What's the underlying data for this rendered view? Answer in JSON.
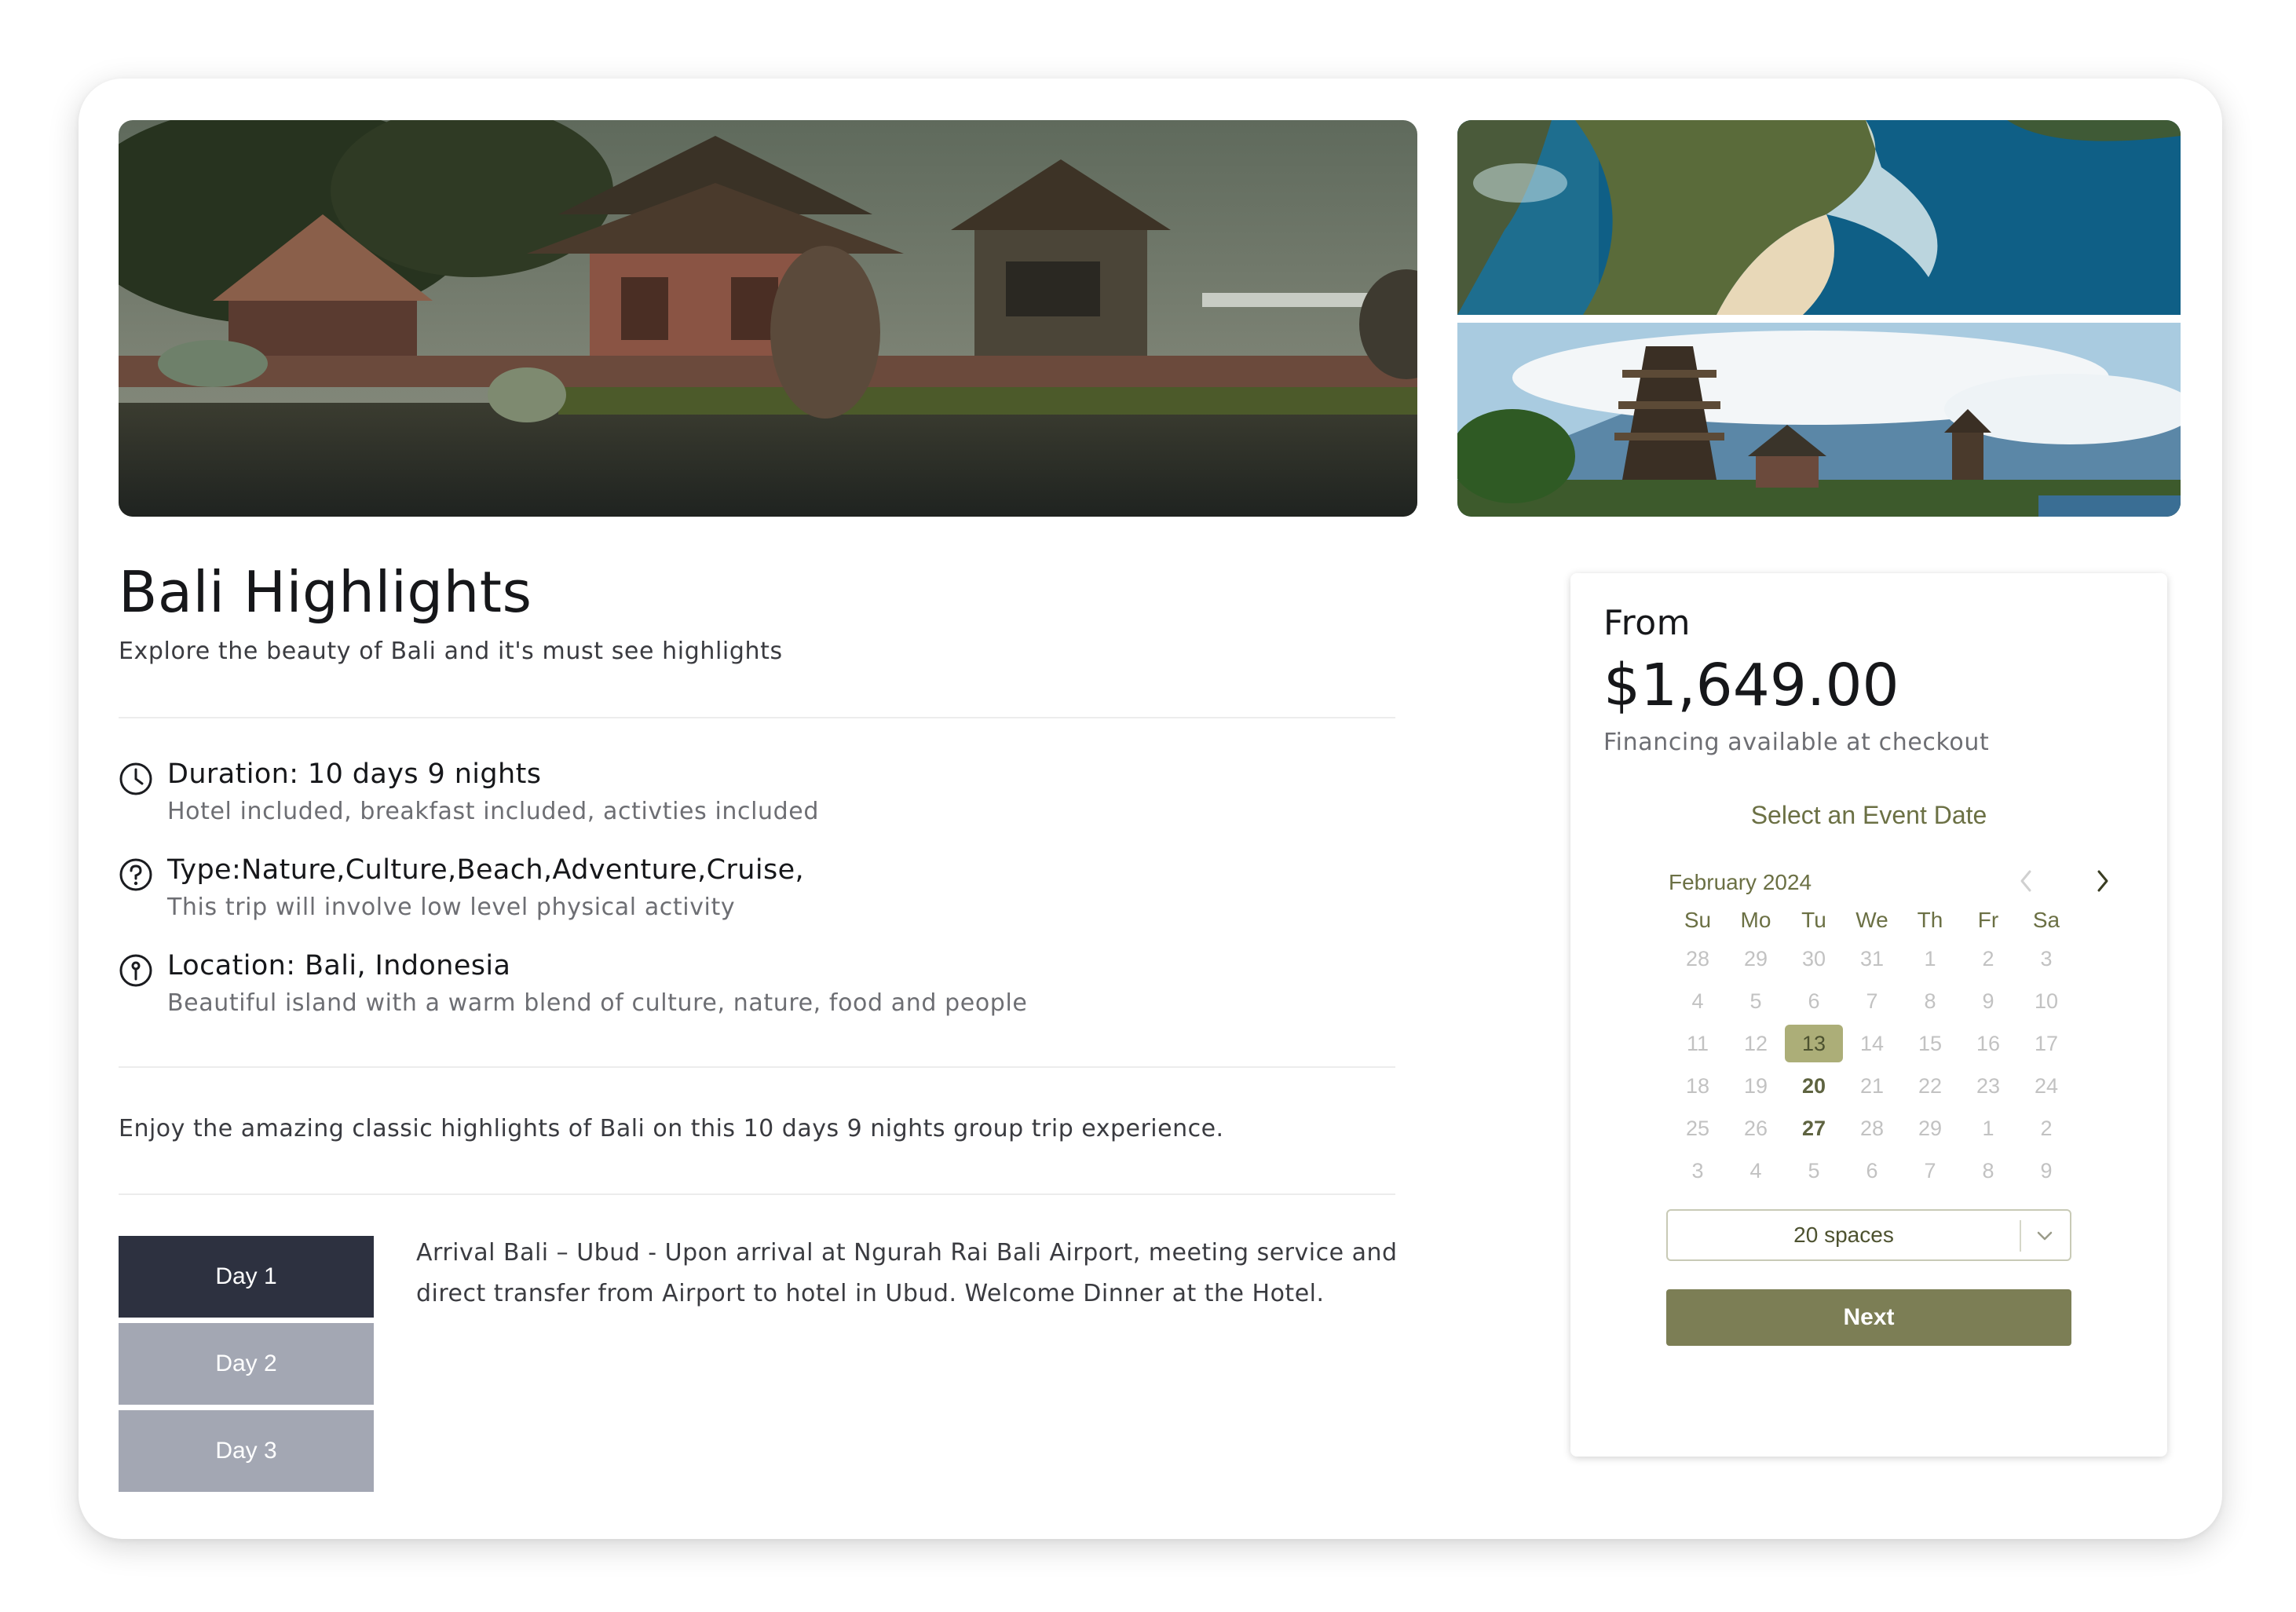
{
  "tour": {
    "title": "Bali Highlights",
    "subtitle": "Explore the beauty of Bali and it's must see highlights",
    "features": [
      {
        "icon": "clock-icon",
        "title": "Duration: 10 days 9 nights",
        "subtitle": "Hotel included, breakfast included, activties included"
      },
      {
        "icon": "question-icon",
        "title": "Type:Nature,Culture,Beach,Adventure,Cruise,",
        "subtitle": "This trip will involve low level physical activity"
      },
      {
        "icon": "info-icon",
        "title": "Location: Bali, Indonesia",
        "subtitle": "Beautiful island with a warm blend of culture, nature, food and people"
      }
    ],
    "description": "Enjoy the amazing classic highlights of Bali on this 10 days 9 nights group trip experience."
  },
  "itinerary": {
    "tabs": [
      "Day 1",
      "Day 2",
      "Day 3"
    ],
    "active_index": 0,
    "active_text": "Arrival Bali – Ubud - Upon arrival at Ngurah Rai Bali Airport, meeting service and direct transfer from Airport to hotel in Ubud. Welcome Dinner at the Hotel."
  },
  "images": [
    {
      "name": "temple-lake-image",
      "subject": "lake temple"
    },
    {
      "name": "coast-cliff-image",
      "subject": "coastal cliff"
    },
    {
      "name": "pagoda-mountain-image",
      "subject": "pagoda and mountain"
    }
  ],
  "booking": {
    "from_label": "From",
    "price": "$1,649.00",
    "financing": "Financing available at checkout",
    "select_label": "Select an Event Date",
    "calendar": {
      "month": "February 2024",
      "weekdays": [
        "Su",
        "Mo",
        "Tu",
        "We",
        "Th",
        "Fr",
        "Sa"
      ],
      "weeks": [
        [
          "28",
          "29",
          "30",
          "31",
          "1",
          "2",
          "3"
        ],
        [
          "4",
          "5",
          "6",
          "7",
          "8",
          "9",
          "10"
        ],
        [
          "11",
          "12",
          "13",
          "14",
          "15",
          "16",
          "17"
        ],
        [
          "18",
          "19",
          "20",
          "21",
          "22",
          "23",
          "24"
        ],
        [
          "25",
          "26",
          "27",
          "28",
          "29",
          "1",
          "2"
        ],
        [
          "3",
          "4",
          "5",
          "6",
          "7",
          "8",
          "9"
        ]
      ],
      "selected": "13",
      "available": [
        "20",
        "27"
      ]
    },
    "spaces": "20 spaces",
    "next_label": "Next"
  },
  "colors": {
    "accent": "#7c7e55",
    "accent_text": "#6b7044",
    "selected_day_bg": "#acae78",
    "tab_active": "#2d3140",
    "tab_inactive": "#a3a7b3"
  }
}
